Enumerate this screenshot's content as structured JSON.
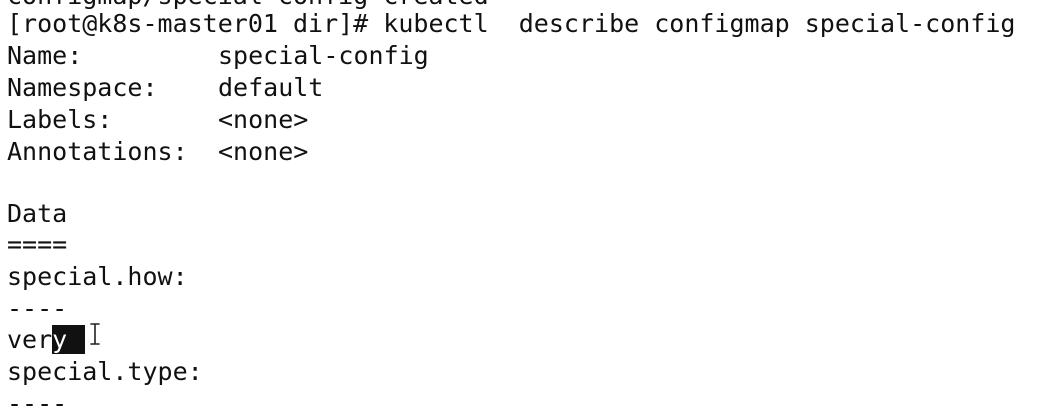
{
  "terminal": {
    "cut_line": "configmap/special-config created",
    "prompt": "[root@k8s-master01 dir]# ",
    "command": "kubectl  describe configmap special-config",
    "fields": [
      {
        "label": "Name:",
        "value": "special-config"
      },
      {
        "label": "Namespace:",
        "value": "default"
      },
      {
        "label": "Labels:",
        "value": "<none>"
      },
      {
        "label": "Annotations:",
        "value": "<none>"
      }
    ],
    "data_header": "Data",
    "data_rule": "====",
    "entries": [
      {
        "key": "special.how:",
        "separator": "----",
        "value_plain": "ver",
        "value_selected": "y"
      },
      {
        "key": "special.type:",
        "separator": "----"
      }
    ]
  },
  "colors": {
    "background": "#ffffff",
    "text": "#111111",
    "selection_background": "#111111",
    "selection_text": "#ffffff"
  },
  "cursor_icon": "text-cursor-icon"
}
